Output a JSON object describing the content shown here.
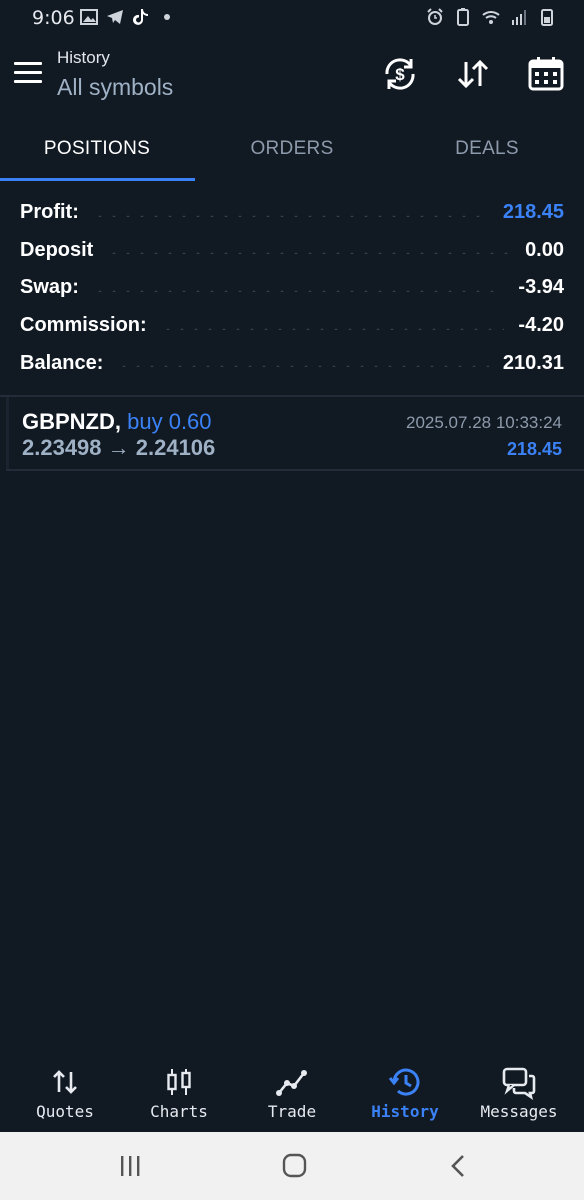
{
  "status_bar": {
    "time": "9:06"
  },
  "app_bar": {
    "title": "History",
    "subtitle": "All symbols"
  },
  "tabs": [
    {
      "label": "POSITIONS",
      "active": true
    },
    {
      "label": "ORDERS",
      "active": false
    },
    {
      "label": "DEALS",
      "active": false
    }
  ],
  "summary": [
    {
      "label": "Profit:",
      "value": "218.45",
      "color": "#3b82f6"
    },
    {
      "label": "Deposit",
      "value": "0.00"
    },
    {
      "label": "Swap:",
      "value": "-3.94"
    },
    {
      "label": "Commission:",
      "value": "-4.20"
    },
    {
      "label": "Balance:",
      "value": "210.31"
    }
  ],
  "positions": [
    {
      "symbol": "GBPNZD,",
      "type": "buy 0.60",
      "prices": "2.23498 → 2.24106",
      "time": "2025.07.28 10:33:24",
      "profit": "218.45"
    }
  ],
  "bottom_nav": [
    {
      "label": "Quotes",
      "icon": "quotes-icon",
      "active": false
    },
    {
      "label": "Charts",
      "icon": "charts-icon",
      "active": false
    },
    {
      "label": "Trade",
      "icon": "trade-icon",
      "active": false
    },
    {
      "label": "History",
      "icon": "history-icon",
      "active": true
    },
    {
      "label": "Messages",
      "icon": "messages-icon",
      "active": false
    }
  ],
  "colors": {
    "background": "#111923",
    "accent": "#3b82f6",
    "muted": "#8d9aab"
  }
}
